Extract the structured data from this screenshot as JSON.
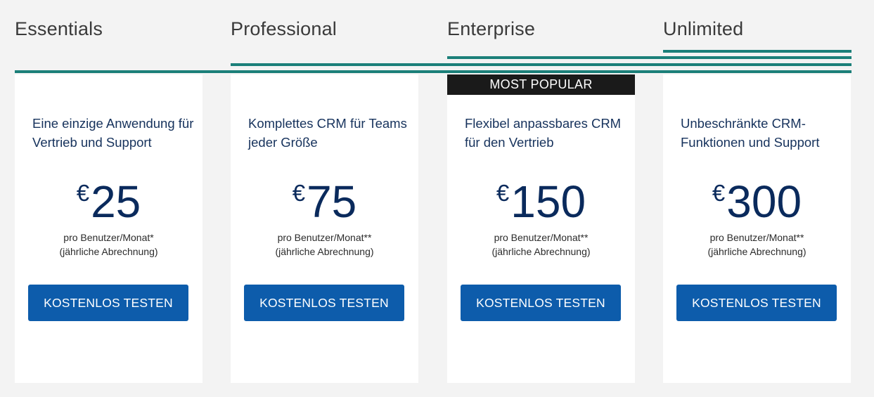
{
  "plans": [
    {
      "name": "Essentials",
      "badge": "",
      "tagline": "Eine einzige Anwendung für Vertrieb und Support",
      "currency": "€",
      "price": "25",
      "price_note_line1": "pro Benutzer/Monat*",
      "price_note_line2": "(jährliche Abrechnung)",
      "cta_label": "KOSTENLOS TESTEN"
    },
    {
      "name": "Professional",
      "badge": "",
      "tagline": "Komplettes CRM für Teams jeder Größe",
      "currency": "€",
      "price": "75",
      "price_note_line1": "pro Benutzer/Monat**",
      "price_note_line2": "(jährliche Abrechnung)",
      "cta_label": "KOSTENLOS TESTEN"
    },
    {
      "name": "Enterprise",
      "badge": "MOST POPULAR",
      "tagline": "Flexibel anpassbares CRM für den Vertrieb",
      "currency": "€",
      "price": "150",
      "price_note_line1": "pro Benutzer/Monat**",
      "price_note_line2": "(jährliche Abrechnung)",
      "cta_label": "KOSTENLOS TESTEN"
    },
    {
      "name": "Unlimited",
      "badge": "",
      "tagline": "Unbeschränkte CRM-Funktionen und Support",
      "currency": "€",
      "price": "300",
      "price_note_line1": "pro Benutzer/Monat**",
      "price_note_line2": "(jährliche Abrechnung)",
      "cta_label": "KOSTENLOS TESTEN"
    }
  ],
  "colors": {
    "accent_line": "#1b7f79",
    "button": "#0d5cab",
    "price_text": "#0a2a5c",
    "badge_bg": "#1a1a1a"
  }
}
